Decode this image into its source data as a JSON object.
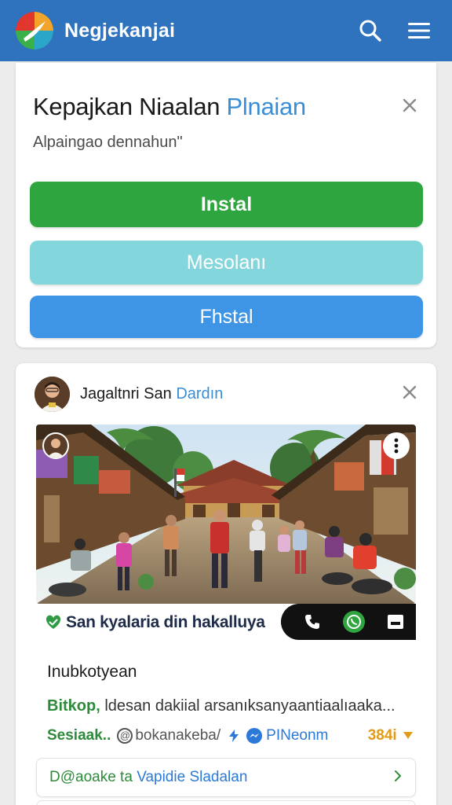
{
  "header": {
    "app_title": "Negjekanjai",
    "logo_icon": "swirl-logo-icon",
    "search_icon": "search-icon",
    "menu_icon": "hamburger-menu-icon",
    "background": "#2f73be"
  },
  "install_card": {
    "title": "Kepajkan Niaalan",
    "title_accent": "Plnaian",
    "subtitle": "Alpaingao dennahun\"",
    "close_icon": "close-icon",
    "buttons": {
      "install": "Instal",
      "secondary": "Mesolanı",
      "tertiary": "Fhstal"
    },
    "colors": {
      "install": "#2ea53e",
      "secondary": "#84d6dd",
      "tertiary": "#3f95e5"
    }
  },
  "post_card": {
    "author": "Jagaltnri San",
    "author_accent": "Dardın",
    "close_icon": "close-icon",
    "media": {
      "scene": "market-street-photo",
      "more_icon": "more-vertical-icon"
    },
    "caption": "San kyalaria din hakalluya",
    "caption_icon": "verified-check-icon",
    "actions": [
      "phone-icon",
      "whatsapp-icon",
      "bookmark-icon"
    ],
    "heading": "Inubkotyean",
    "description_lead": "Bitkop,",
    "description": "ldesan dakiial arsanıksanyaantiaalıaaka...",
    "meta": {
      "source": "Sesiaak..",
      "handle": "bokanakeba/",
      "platform": "PINeonm",
      "count": "384i"
    },
    "link": {
      "text": "D@aoake ta",
      "accent": "Vapidie Sladalan"
    }
  }
}
